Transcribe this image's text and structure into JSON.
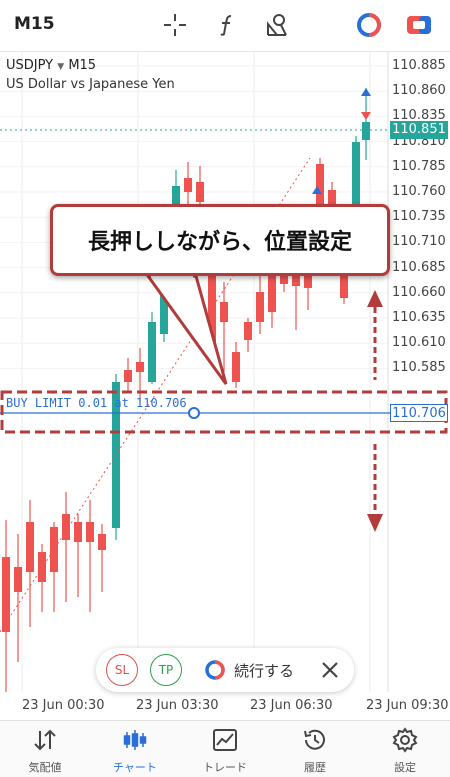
{
  "toolbar": {
    "timeframe": "M15"
  },
  "chart_header": {
    "symbol": "USDJPY",
    "timeframe": "M15",
    "description": "US Dollar vs Japanese Yen"
  },
  "price_axis": [
    "110.885",
    "110.860",
    "110.835",
    "110.810",
    "110.785",
    "110.760",
    "110.735",
    "110.710",
    "110.685",
    "110.660",
    "110.635",
    "110.610",
    "110.585"
  ],
  "time_axis": [
    "23 Jun 00:30",
    "23 Jun 03:30",
    "23 Jun 06:30",
    "23 Jun 09:30"
  ],
  "current_price": "110.851",
  "order": {
    "label": "BUY LIMIT 0.01 at 110.706",
    "price_tag": "110.706"
  },
  "callout": {
    "text": "長押ししながら、位置設定"
  },
  "actions": {
    "sl": "SL",
    "tp": "TP",
    "continue": "続行する"
  },
  "nav": [
    {
      "label": "気配値",
      "icon": "quotes-icon"
    },
    {
      "label": "チャート",
      "icon": "chart-icon"
    },
    {
      "label": "トレード",
      "icon": "trade-icon"
    },
    {
      "label": "履歴",
      "icon": "history-icon"
    },
    {
      "label": "設定",
      "icon": "settings-icon"
    }
  ],
  "colors": {
    "bull": "#26a69a",
    "bear": "#ef5350",
    "accent": "#2a6fd6",
    "annotation": "#b23b3b",
    "current_price_bg": "#26a69a"
  }
}
